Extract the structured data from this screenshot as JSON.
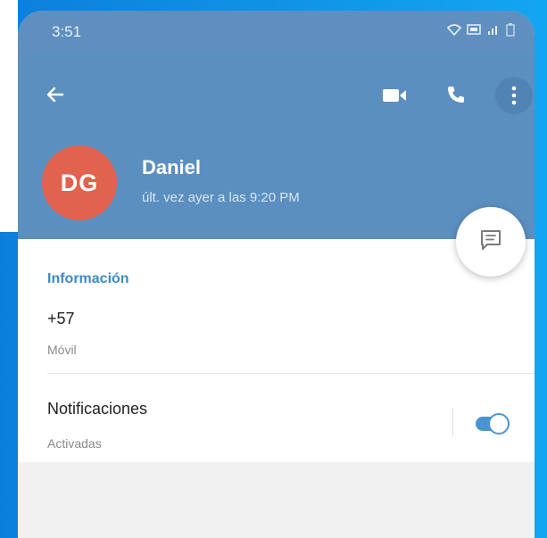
{
  "status_bar": {
    "time": "3:51",
    "icons": [
      "wifi-icon",
      "data-icon",
      "signal-icon",
      "battery-icon"
    ]
  },
  "header": {
    "avatar_initials": "DG",
    "name": "Daniel",
    "last_seen": "últ. vez ayer a las 9:20 PM",
    "actions": [
      "back-arrow-icon",
      "video-call-icon",
      "phone-call-icon",
      "more-vert-icon"
    ]
  },
  "info": {
    "section_title": "Información",
    "phone": "+57",
    "phone_type": "Móvil"
  },
  "notifications": {
    "label": "Notificaciones",
    "status": "Activadas",
    "enabled": true
  },
  "colors": {
    "header": "#5b8fc0",
    "avatar": "#e0624f",
    "accent": "#4b93d1",
    "section_title": "#3d8ac4"
  }
}
